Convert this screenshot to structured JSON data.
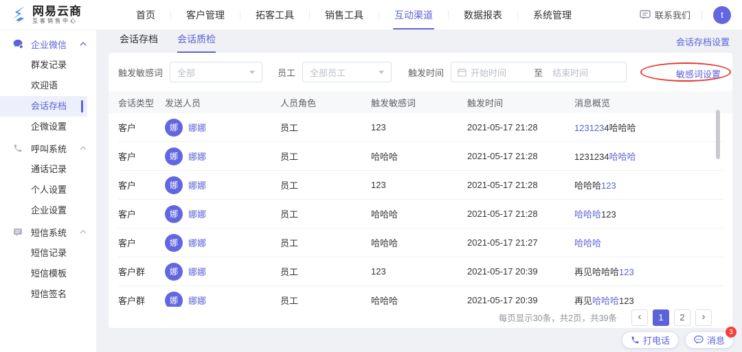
{
  "colors": {
    "accent": "#5B63D8",
    "avatar_bg": "#6266E0",
    "logo_blue": "#3178E6",
    "badge_red": "#F3403A",
    "annotation_red": "#E6382D"
  },
  "topbar": {
    "brand": {
      "name": "网易云商",
      "subtitle": "互客销售中心"
    },
    "nav_items": [
      "首页",
      "客户管理",
      "拓客工具",
      "销售工具",
      "互动渠道",
      "数据报表",
      "系统管理"
    ],
    "active_nav": "互动渠道",
    "contact_label": "联系我们",
    "avatar_text": "t"
  },
  "sidebar": {
    "groups": [
      {
        "icon": "wecom-chat-icon",
        "label": "企业微信",
        "items": [
          "群发记录",
          "欢迎语",
          "会话存档",
          "企微设置"
        ]
      },
      {
        "icon": "phone-icon",
        "label": "呼叫系统",
        "items": [
          "通话记录",
          "个人设置",
          "企业设置"
        ]
      },
      {
        "icon": "sms-icon",
        "label": "短信系统",
        "items": [
          "短信记录",
          "短信模板",
          "短信签名"
        ]
      }
    ],
    "active_item": "会话存档"
  },
  "tabs": {
    "items": [
      "会话存档",
      "会话质检"
    ],
    "active": "会话质检",
    "settings_link": "会话存档设置"
  },
  "filters": {
    "keyword_label": "触发敏感词",
    "keyword_value": "全部",
    "staff_label": "员工",
    "staff_value": "全部员工",
    "time_label": "触发时间",
    "start_placeholder": "开始时间",
    "range_separator": "至",
    "end_placeholder": "结束时间",
    "keyword_settings_link": "敏感词设置"
  },
  "table": {
    "columns": [
      "会话类型",
      "发送人员",
      "人员角色",
      "触发敏感词",
      "触发时间",
      "消息概览"
    ],
    "rows": [
      {
        "type": "客户",
        "avatar": "娜",
        "sender": "娜娜",
        "role": "员工",
        "keyword": "123",
        "time": "2021-05-17 21:28",
        "message": [
          {
            "t": "123123",
            "hl": true
          },
          {
            "t": "4哈哈哈",
            "hl": false
          }
        ]
      },
      {
        "type": "客户",
        "avatar": "娜",
        "sender": "娜娜",
        "role": "员工",
        "keyword": "哈哈哈",
        "time": "2021-05-17 21:28",
        "message": [
          {
            "t": "1231234",
            "hl": false
          },
          {
            "t": "哈哈哈",
            "hl": true
          }
        ]
      },
      {
        "type": "客户",
        "avatar": "娜",
        "sender": "娜娜",
        "role": "员工",
        "keyword": "123",
        "time": "2021-05-17 21:28",
        "message": [
          {
            "t": "哈哈哈",
            "hl": false
          },
          {
            "t": "123",
            "hl": true
          }
        ]
      },
      {
        "type": "客户",
        "avatar": "娜",
        "sender": "娜娜",
        "role": "员工",
        "keyword": "哈哈哈",
        "time": "2021-05-17 21:28",
        "message": [
          {
            "t": "哈哈哈",
            "hl": true
          },
          {
            "t": "123",
            "hl": false
          }
        ]
      },
      {
        "type": "客户",
        "avatar": "娜",
        "sender": "娜娜",
        "role": "员工",
        "keyword": "哈哈哈",
        "time": "2021-05-17 21:27",
        "message": [
          {
            "t": "哈哈哈",
            "hl": true
          }
        ]
      },
      {
        "type": "客户群",
        "avatar": "娜",
        "sender": "娜娜",
        "role": "员工",
        "keyword": "123",
        "time": "2021-05-17 20:39",
        "message": [
          {
            "t": "再见哈哈哈",
            "hl": false
          },
          {
            "t": "123",
            "hl": true
          }
        ]
      },
      {
        "type": "客户群",
        "avatar": "娜",
        "sender": "娜娜",
        "role": "员工",
        "keyword": "哈哈哈",
        "time": "2021-05-17 20:39",
        "message": [
          {
            "t": "再见",
            "hl": false
          },
          {
            "t": "哈哈哈",
            "hl": true
          },
          {
            "t": "123",
            "hl": false
          }
        ]
      }
    ]
  },
  "pagination": {
    "summary": "每页显示30条，共2页，共39条",
    "prev": "‹",
    "next": "›",
    "pages": [
      "1",
      "2"
    ],
    "active_page": "1"
  },
  "floating_buttons": {
    "call_label": "打电话",
    "message_label": "消息",
    "badge": "3"
  }
}
